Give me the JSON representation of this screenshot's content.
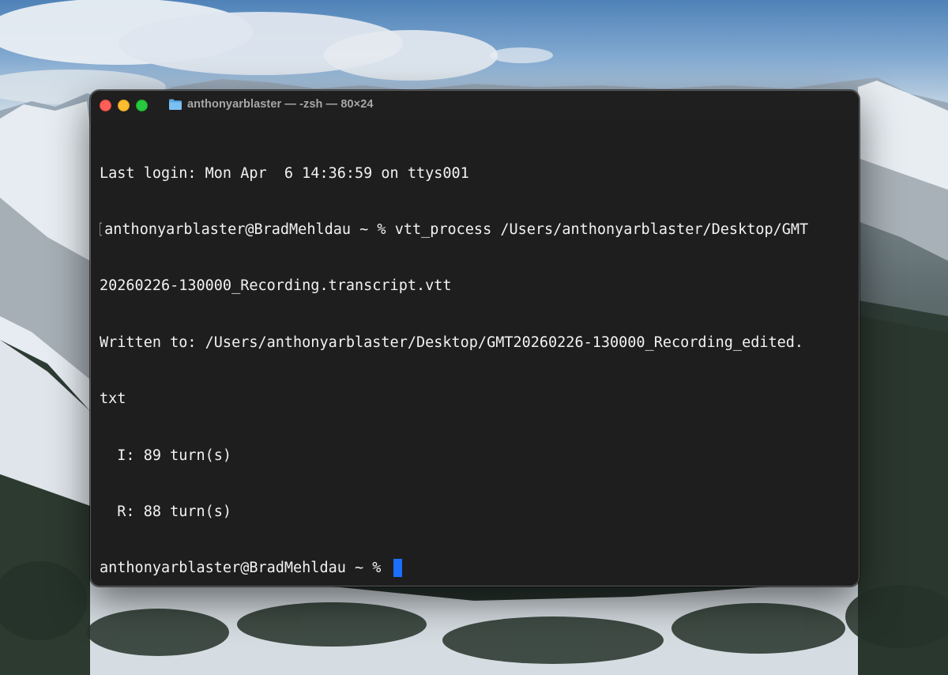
{
  "terminal": {
    "title": "anthonyarblaster — -zsh — 80×24",
    "lines": {
      "l0": "Last login: Mon Apr  6 14:36:59 on ttys001",
      "l1": "anthonyarblaster@BradMehldau ~ % vtt_process /Users/anthonyarblaster/Desktop/GMT",
      "l2": "20260226-130000_Recording.transcript.vtt",
      "l3": "Written to: /Users/anthonyarblaster/Desktop/GMT20260226-130000_Recording_edited.",
      "l4": "txt",
      "l5": "  I: 89 turn(s)",
      "l6": "  R: 88 turn(s)",
      "l7": "anthonyarblaster@BradMehldau ~ % "
    },
    "icon": "folder-icon",
    "colors": {
      "background": "#1e1e1e",
      "text": "#f2f2f2",
      "cursor": "#1a6fff",
      "close": "#ff5f57",
      "minimize": "#febc2e",
      "zoom": "#28c840"
    }
  }
}
